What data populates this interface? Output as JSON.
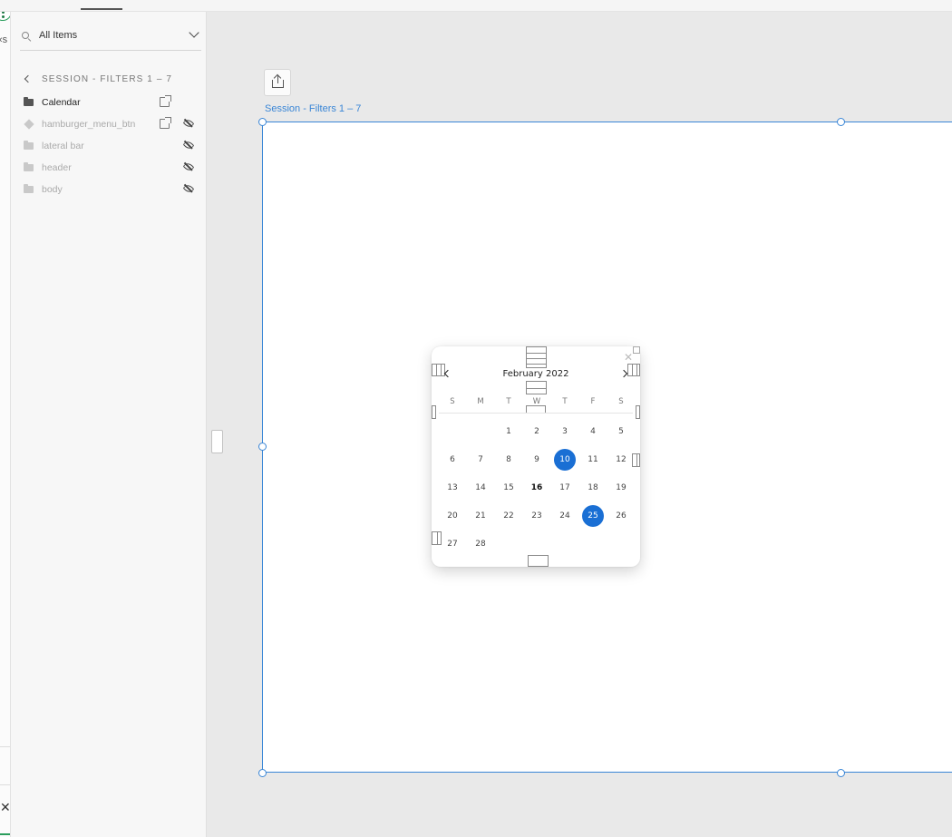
{
  "topbar": {
    "tab_fragment": "·"
  },
  "left_strip": {
    "label_fragment": "‹s",
    "close_glyph": "✕"
  },
  "layers_panel": {
    "search": {
      "value": "All Items"
    },
    "breadcrumb": "SESSION - FILTERS 1 – 7",
    "items": [
      {
        "label": "Calendar",
        "type": "folder",
        "dimmed": false,
        "external_link": true,
        "hidden": false
      },
      {
        "label": "hamburger_menu_btn",
        "type": "component",
        "dimmed": true,
        "external_link": true,
        "hidden": true
      },
      {
        "label": "lateral bar",
        "type": "folder",
        "dimmed": true,
        "external_link": false,
        "hidden": true
      },
      {
        "label": "header",
        "type": "folder",
        "dimmed": true,
        "external_link": false,
        "hidden": true
      },
      {
        "label": "body",
        "type": "folder",
        "dimmed": true,
        "external_link": false,
        "hidden": true
      }
    ]
  },
  "canvas": {
    "frame_label": "Session - Filters 1 – 7",
    "selection_color": "#3a86d6"
  },
  "calendar": {
    "month_label": "February 2022",
    "weekdays": [
      "S",
      "M",
      "T",
      "W",
      "T",
      "F",
      "S"
    ],
    "days": [
      "1",
      "2",
      "3",
      "4",
      "5",
      "6",
      "7",
      "8",
      "9",
      "10",
      "11",
      "12",
      "13",
      "14",
      "15",
      "16",
      "17",
      "18",
      "19",
      "20",
      "21",
      "22",
      "23",
      "24",
      "25",
      "26",
      "27",
      "28"
    ],
    "first_weekday_index": 2,
    "selected_days": [
      "10",
      "25"
    ],
    "today": "16",
    "accent_color": "#1a6fd4"
  }
}
